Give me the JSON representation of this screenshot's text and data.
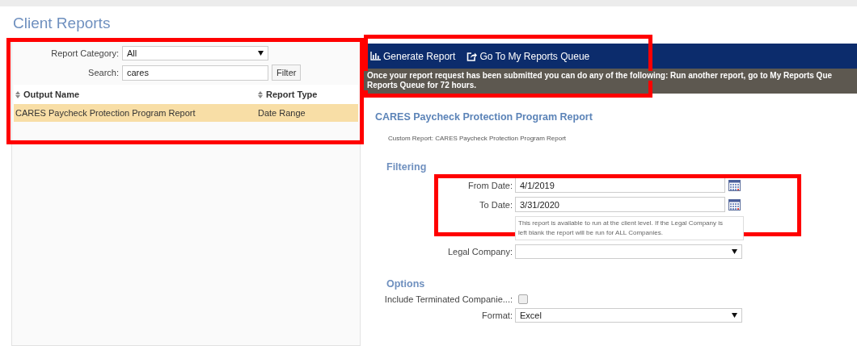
{
  "page_title": "Client Reports",
  "left_panel": {
    "category": {
      "label": "Report Category:",
      "value": "All"
    },
    "search": {
      "label": "Search:",
      "value": "cares",
      "button": "Filter"
    },
    "table": {
      "columns": [
        "Output Name",
        "Report Type"
      ],
      "rows": [
        {
          "cells": [
            "CARES Paycheck Protection Program Report",
            "Date Range"
          ],
          "selected": true
        }
      ]
    }
  },
  "toolbar": {
    "actions": [
      {
        "label": "Generate Report",
        "kind": "chart"
      },
      {
        "label": "Go To My Reports Queue",
        "kind": "share"
      }
    ]
  },
  "notice": {
    "lines": [
      "Once your report request has been submitted you can do any of the following: Run another report, go to My Reports Que",
      "Reports Queue for 72 hours."
    ]
  },
  "report": {
    "title": "CARES Paycheck Protection Program Report",
    "subtitle": "Custom Report: CARES Paycheck Protection Program Report",
    "sections": [
      {
        "heading": "Filtering",
        "fields": [
          {
            "kind": "date",
            "label": "From Date:",
            "value": "4/1/2019"
          },
          {
            "kind": "date",
            "label": "To Date:",
            "value": "3/31/2020"
          },
          {
            "kind": "note",
            "text": "This report is available to run at the client level. If the Legal Company is left blank the report will be run for ALL Companies."
          },
          {
            "kind": "select",
            "label": "Legal Company:"
          }
        ]
      },
      {
        "heading": "Options",
        "fields": [
          {
            "kind": "checkbox",
            "label": "Include Terminated Companie...:",
            "checked": false
          },
          {
            "kind": "select",
            "label": "Format:",
            "value": "Excel"
          }
        ]
      }
    ]
  }
}
